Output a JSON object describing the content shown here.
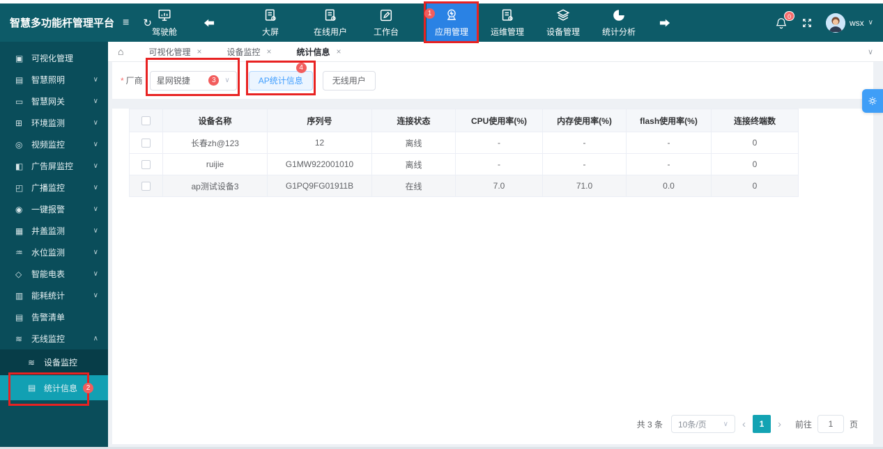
{
  "app": {
    "title": "智慧多功能杆管理平台",
    "username": "wsx"
  },
  "annotations": {
    "n1": "1",
    "n2": "2",
    "n3": "3",
    "n4": "4"
  },
  "navbar": {
    "items": [
      {
        "label": "驾驶舱"
      },
      {
        "label": "大屏"
      },
      {
        "label": "在线用户"
      },
      {
        "label": "工作台"
      },
      {
        "label": "应用管理"
      },
      {
        "label": "运维管理"
      },
      {
        "label": "设备管理"
      },
      {
        "label": "统计分析"
      }
    ],
    "bell_badge": "0"
  },
  "sidebar": {
    "items": [
      {
        "glyph": "▣",
        "label": "可视化管理",
        "chevron": ""
      },
      {
        "glyph": "▤",
        "label": "智慧照明",
        "chevron": "∨"
      },
      {
        "glyph": "▭",
        "label": "智慧网关",
        "chevron": "∨"
      },
      {
        "glyph": "⊞",
        "label": "环境监测",
        "chevron": "∨"
      },
      {
        "glyph": "◎",
        "label": "视频监控",
        "chevron": "∨"
      },
      {
        "glyph": "◧",
        "label": "广告屏监控",
        "chevron": "∨"
      },
      {
        "glyph": "◰",
        "label": "广播监控",
        "chevron": "∨"
      },
      {
        "glyph": "◉",
        "label": "一键报警",
        "chevron": "∨"
      },
      {
        "glyph": "▦",
        "label": "井盖监测",
        "chevron": "∨"
      },
      {
        "glyph": "♒",
        "label": "水位监测",
        "chevron": "∨"
      },
      {
        "glyph": "◇",
        "label": "智能电表",
        "chevron": "∨"
      },
      {
        "glyph": "▥",
        "label": "能耗统计",
        "chevron": "∨"
      },
      {
        "glyph": "▤",
        "label": "告警清单",
        "chevron": ""
      },
      {
        "glyph": "≋",
        "label": "无线监控",
        "chevron": "∧"
      }
    ],
    "subitems": [
      {
        "glyph": "≋",
        "label": "设备监控"
      },
      {
        "glyph": "▤",
        "label": "统计信息"
      }
    ]
  },
  "tabbar": {
    "tabs": [
      {
        "label": "可视化管理"
      },
      {
        "label": "设备监控"
      },
      {
        "label": "统计信息"
      }
    ]
  },
  "filter": {
    "required_mark": "*",
    "vendor_label": "厂商",
    "vendor_value": "星网锐捷",
    "ap_button": "AP统计信息",
    "wireless_user_button": "无线用户"
  },
  "table": {
    "columns": [
      "设备名称",
      "序列号",
      "连接状态",
      "CPU使用率(%)",
      "内存使用率(%)",
      "flash使用率(%)",
      "连接终端数"
    ],
    "rows": [
      {
        "name": "长春zh@123",
        "serial": "12",
        "status": "离线",
        "cpu": "-",
        "memory": "-",
        "flash": "-",
        "terminals": "0"
      },
      {
        "name": "ruijie",
        "serial": "G1MW922001010",
        "status": "离线",
        "cpu": "-",
        "memory": "-",
        "flash": "-",
        "terminals": "0"
      },
      {
        "name": "ap测试设备3",
        "serial": "G1PQ9FG01911B",
        "status": "在线",
        "cpu": "7.0",
        "memory": "71.0",
        "flash": "0.0",
        "terminals": "0"
      }
    ]
  },
  "pagination": {
    "total": "共 3 条",
    "page_size": "10条/页",
    "current_page": "1",
    "goto_label": "前往",
    "goto_value": "1",
    "page_unit": "页"
  },
  "icons": {
    "chevron_down": "∨",
    "chevron_up": "∧",
    "close": "×",
    "home": "⌂",
    "collapse": "≡",
    "refresh": "↻",
    "prev": "‹",
    "next": "›"
  },
  "colors": {
    "navbar_bg": "#0d5b68",
    "sidebar_bg": "#0a4d5a",
    "active_nav_blue": "#2a82e4",
    "active_menu_teal": "#12a0b3",
    "annotation_red": "#e82222",
    "badge_red": "#f25d5d",
    "primary_blue": "#409eff",
    "pagination_active_teal": "#13a3b3"
  }
}
